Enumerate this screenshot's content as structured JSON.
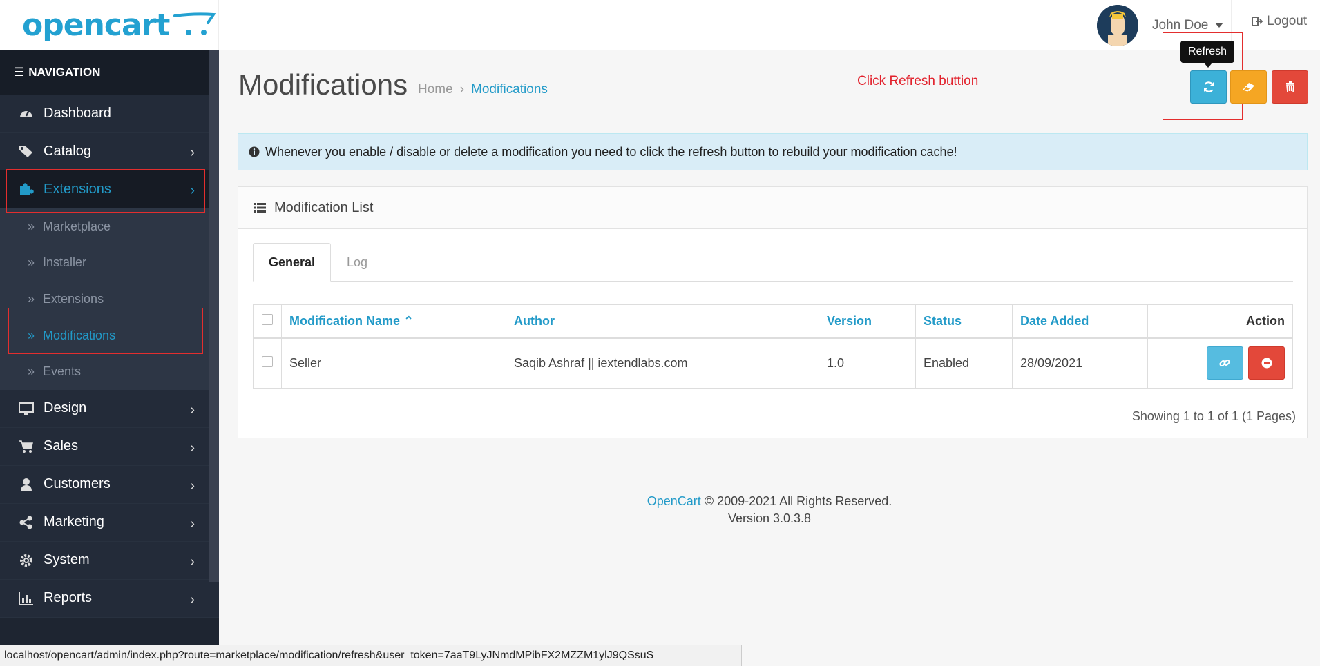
{
  "header": {
    "logo": "opencart",
    "user_name": "John Doe",
    "logout": "Logout"
  },
  "sidebar": {
    "heading": "NAVIGATION",
    "items": [
      {
        "label": "Dashboard",
        "icon": "dashboard-icon"
      },
      {
        "label": "Catalog",
        "icon": "tags-icon"
      },
      {
        "label": "Extensions",
        "icon": "puzzle-icon"
      },
      {
        "label": "Design",
        "icon": "monitor-icon"
      },
      {
        "label": "Sales",
        "icon": "cart-icon"
      },
      {
        "label": "Customers",
        "icon": "user-icon"
      },
      {
        "label": "Marketing",
        "icon": "share-icon"
      },
      {
        "label": "System",
        "icon": "gear-icon"
      },
      {
        "label": "Reports",
        "icon": "bar-chart-icon"
      }
    ],
    "extensions_sub": [
      "Marketplace",
      "Installer",
      "Extensions",
      "Modifications",
      "Events"
    ]
  },
  "page": {
    "title": "Modifications",
    "breadcrumb_home": "Home",
    "breadcrumb_sep": "›",
    "breadcrumb_current": "Modifications",
    "annotation": "Click Refresh buttion",
    "tooltip": "Refresh"
  },
  "alert": "Whenever you enable / disable or delete a modification you need to click the refresh button to rebuild your modification cache!",
  "panel": {
    "title": "Modification List",
    "tabs": [
      "General",
      "Log"
    ],
    "columns": [
      "Modification Name",
      "Author",
      "Version",
      "Status",
      "Date Added",
      "Action"
    ],
    "rows": [
      {
        "name": "Seller",
        "author": "Saqib Ashraf || iextendlabs.com",
        "version": "1.0",
        "status": "Enabled",
        "date": "28/09/2021"
      }
    ],
    "pagination": "Showing 1 to 1 of 1 (1 Pages)"
  },
  "footer": {
    "brand": "OpenCart",
    "copyright": " © 2009-2021 All Rights Reserved.",
    "version": "Version 3.0.3.8"
  },
  "statusbar": "localhost/opencart/admin/index.php?route=marketplace/modification/refresh&user_token=7aaT9LyJNmdMPibFX2MZZM1ylJ9QSsuS",
  "colors": {
    "accent": "#229ac8",
    "sidebar": "#1e2531",
    "info_button": "#3cb1d8",
    "warning_button": "#f5a623",
    "danger_button": "#e3483a",
    "highlight": "#e32e2e"
  }
}
